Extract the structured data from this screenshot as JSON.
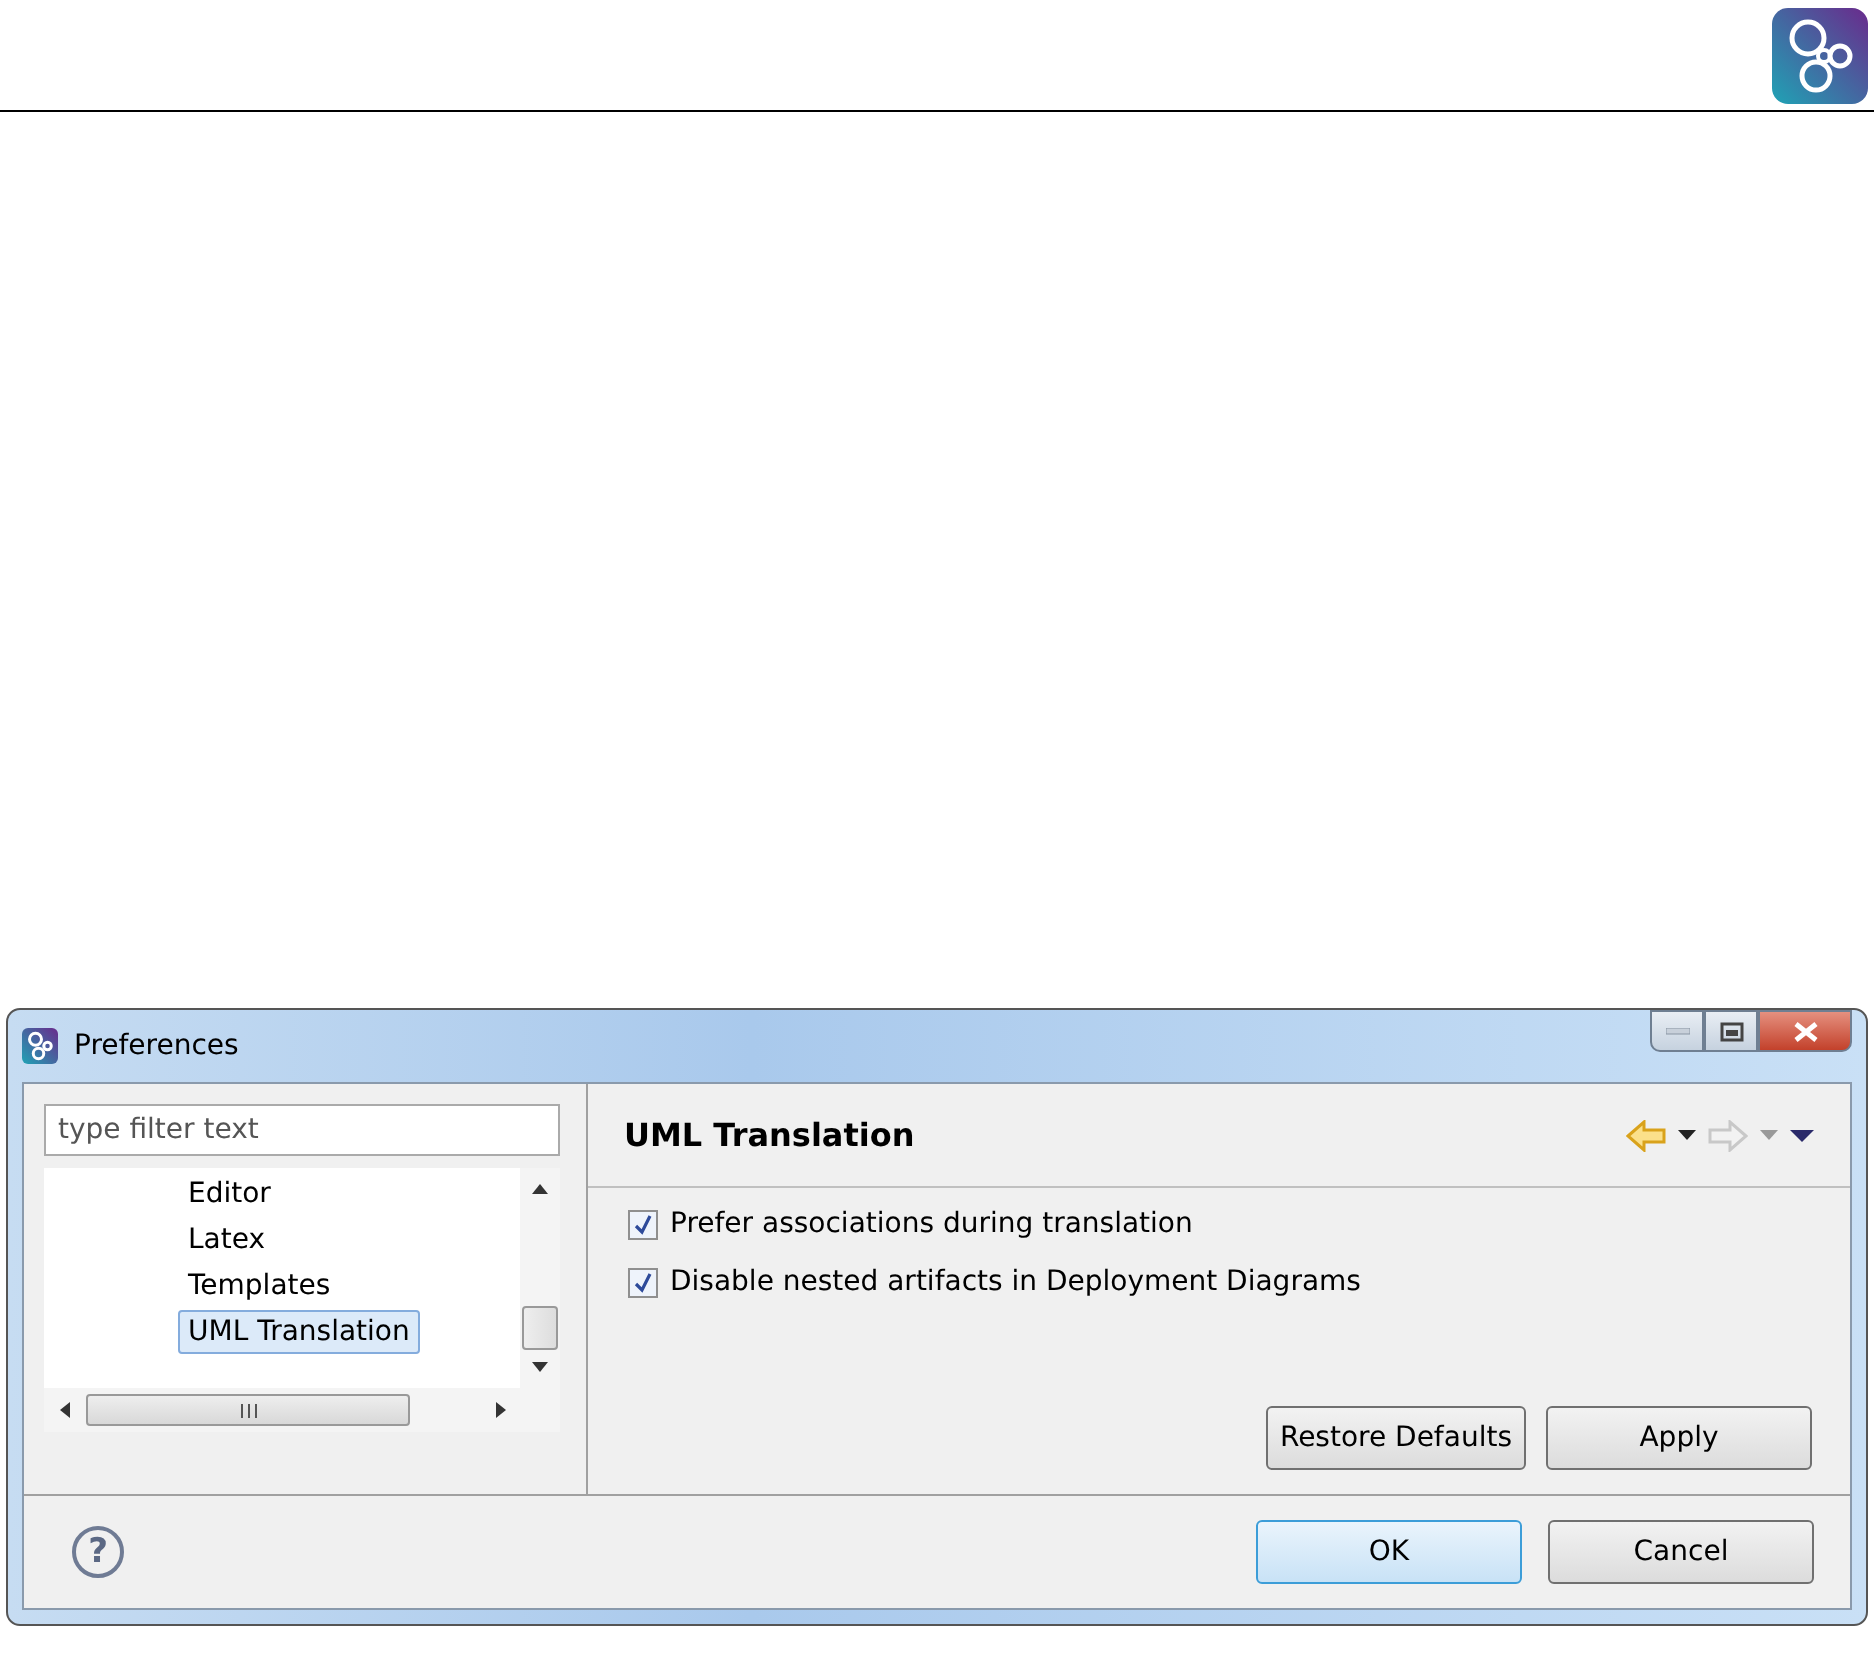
{
  "dialog": {
    "title": "Preferences"
  },
  "filter": {
    "placeholder": "type filter text"
  },
  "tree": [
    {
      "label": "Editor",
      "selected": false
    },
    {
      "label": "Latex",
      "selected": false
    },
    {
      "label": "Templates",
      "selected": false
    },
    {
      "label": "UML Translation",
      "selected": true
    }
  ],
  "page": {
    "title": "UML Translation",
    "back_enabled": true,
    "forward_enabled": false
  },
  "options": [
    {
      "label": "Prefer associations during translation",
      "checked": true
    },
    {
      "label": "Disable nested artifacts in Deployment Diagrams",
      "checked": true
    }
  ],
  "page_buttons": [
    "Restore Defaults",
    "Apply"
  ],
  "help": "?",
  "buttons": [
    {
      "label": "OK",
      "default": true
    },
    {
      "label": "Cancel",
      "default": false
    }
  ]
}
